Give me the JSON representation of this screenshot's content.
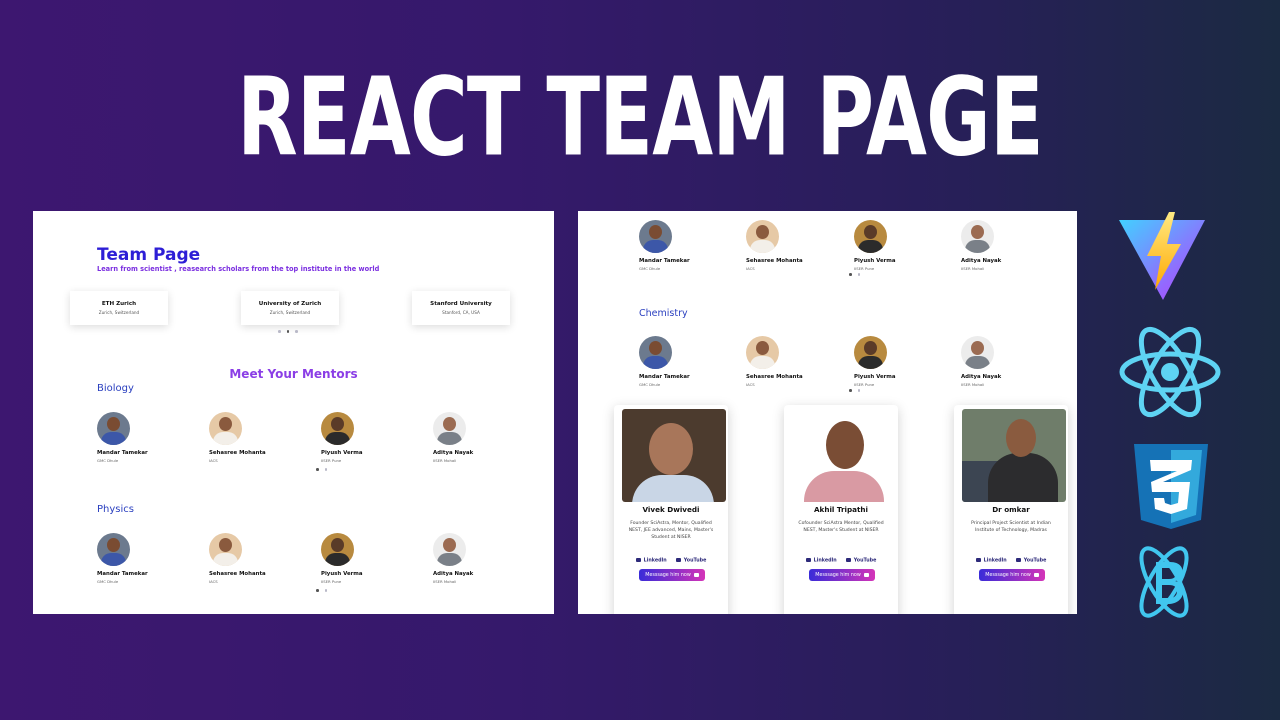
{
  "hero": {
    "title": "REACT TEAM PAGE"
  },
  "left": {
    "title": "Team Page",
    "subtitle": "Learn from scientist , reasearch scholars from the top institute in the world",
    "universities": [
      {
        "name": "ETH Zurich",
        "location": "Zurich, Switzerland"
      },
      {
        "name": "University of Zurich",
        "location": "Zurich, Switzerland"
      },
      {
        "name": "Stanford University",
        "location": "Stanford, CA, USA"
      }
    ],
    "meet": "Meet Your Mentors",
    "sections": [
      {
        "title": "Biology"
      },
      {
        "title": "Physics"
      }
    ]
  },
  "mentors": [
    {
      "name": "Mandar Tamekar",
      "institute": "GMC Dhule"
    },
    {
      "name": "Sehasree Mohanta",
      "institute": "IACS"
    },
    {
      "name": "Piyush Verma",
      "institute": "IISER Pune"
    },
    {
      "name": "Aditya Nayak",
      "institute": "IISER Mohali"
    }
  ],
  "right": {
    "chemistry": "Chemistry",
    "founders": [
      {
        "name": "Vivek Dwivedi",
        "desc": "Founder SciAstra, Mentor, Qualified NEST, JEE advanced, Mains, Master's Student at NISER"
      },
      {
        "name": "Akhil Tripathi",
        "desc": "Cofounder SciAstra Mentor, Qualified NEST, Master's Student at NISER"
      },
      {
        "name": "Dr omkar",
        "desc": "Principal Project Scientist at Indian Institute of Technology, Madras"
      }
    ],
    "linkedin": "LinkedIn",
    "youtube": "YouTube",
    "message": "Messsage him now"
  },
  "logos": [
    "vite-icon",
    "react-icon",
    "css3-icon",
    "react-bootstrap-icon"
  ]
}
